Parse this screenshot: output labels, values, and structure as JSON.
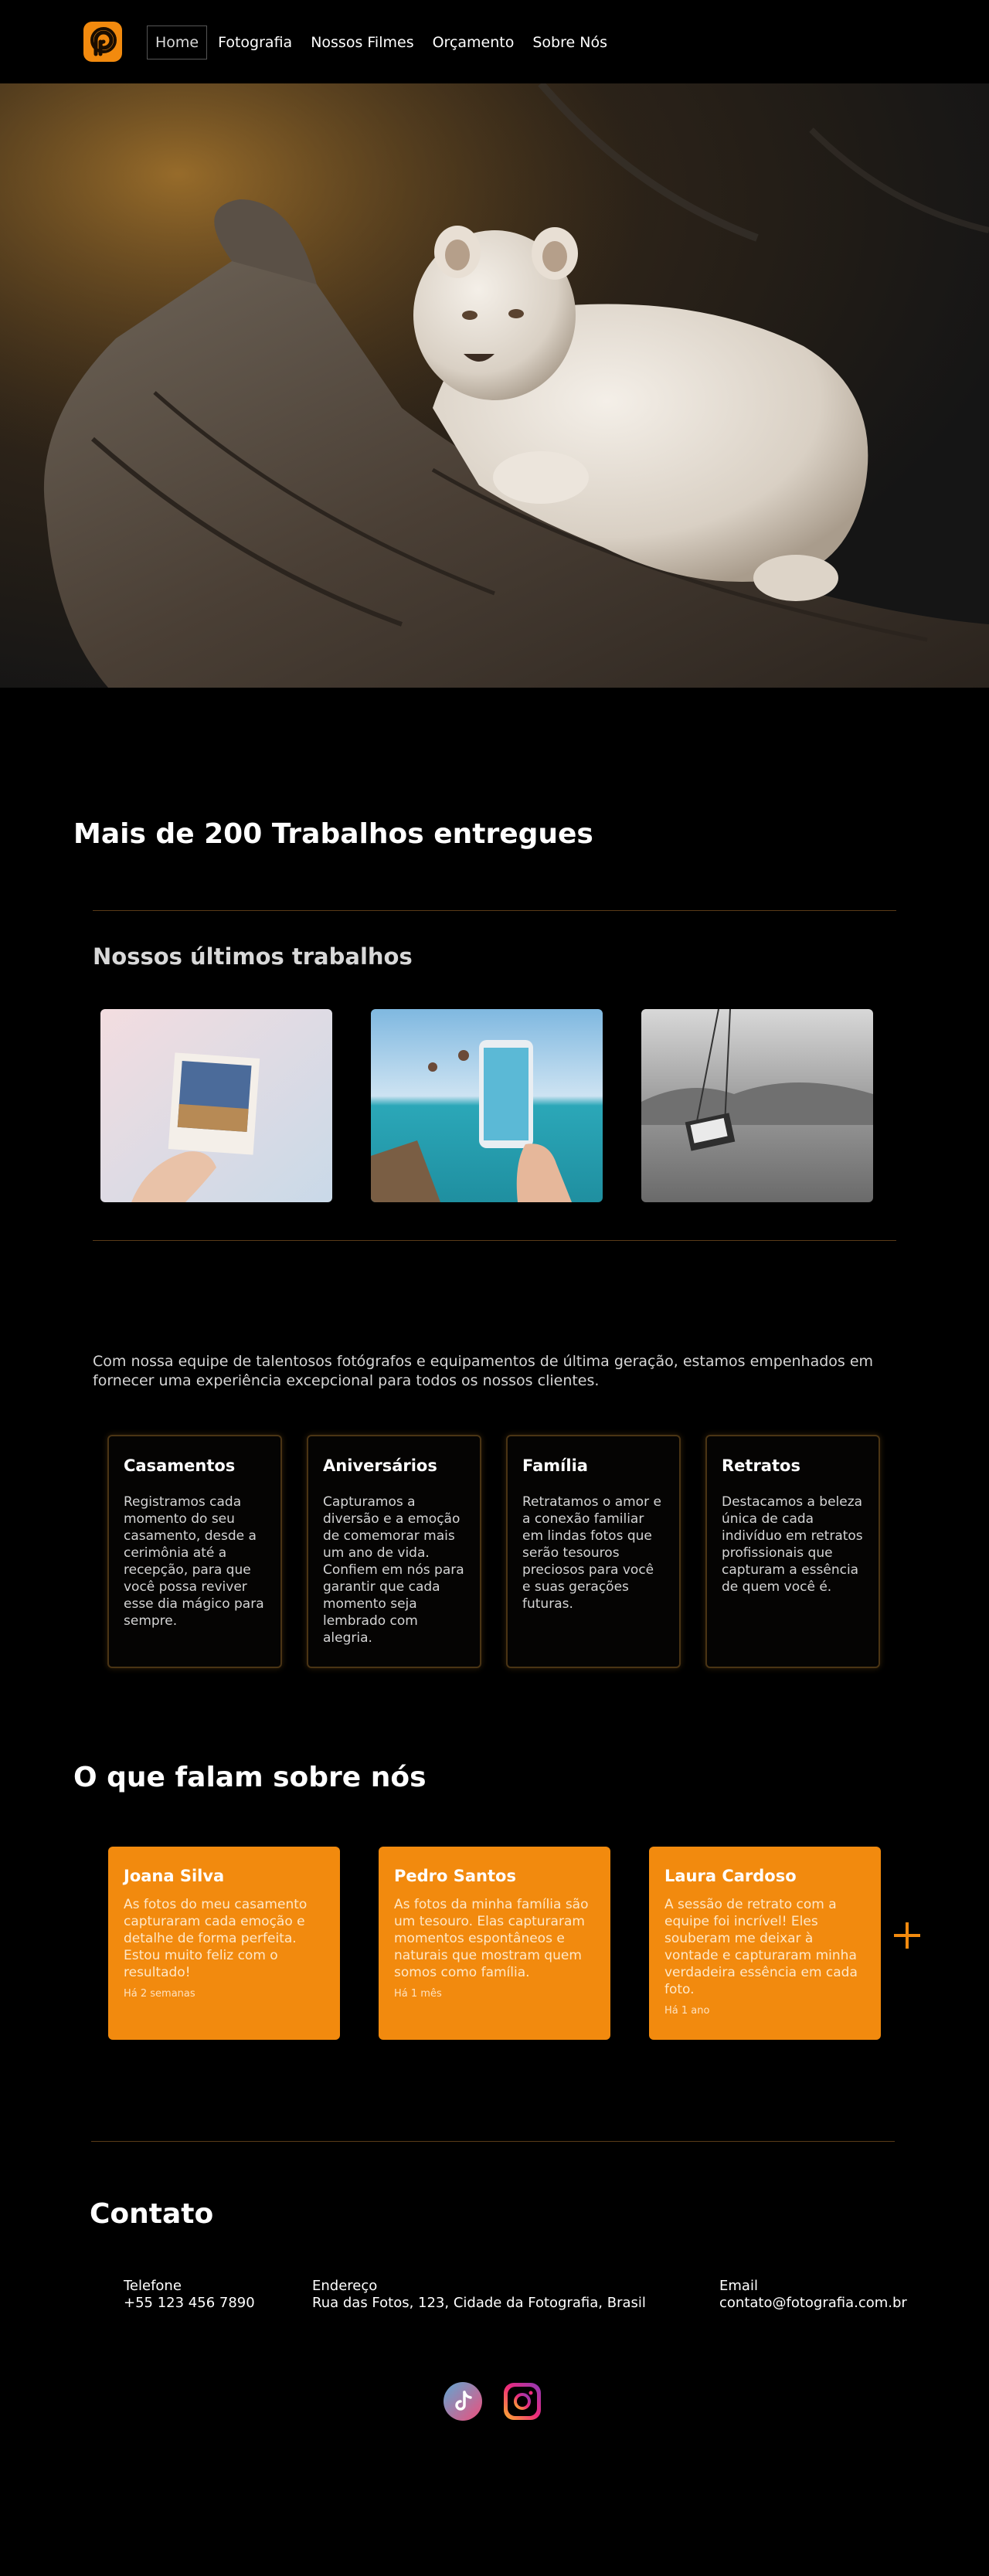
{
  "nav": {
    "items": [
      {
        "label": "Home",
        "active": true
      },
      {
        "label": "Fotografia"
      },
      {
        "label": "Nossos Filmes"
      },
      {
        "label": "Orçamento"
      },
      {
        "label": "Sobre Nós"
      }
    ]
  },
  "hero": {
    "image": "white-lion-cub-on-log-photo"
  },
  "stats": {
    "title": "Mais de 200 Trabalhos entregues"
  },
  "works": {
    "title": "Nossos últimos trabalhos",
    "items": [
      {
        "image": "polaroid-in-hand-photo"
      },
      {
        "image": "people-jumping-into-sea-phone-photo"
      },
      {
        "image": "black-white-swing-photo"
      }
    ]
  },
  "intro": "Com nossa equipe de talentosos fotógrafos e equipamentos de última geração, estamos empenhados em fornecer uma experiência excepcional para todos os nossos clientes.",
  "services": [
    {
      "title": "Casamentos",
      "text": "Registramos cada momento do seu casamento, desde a cerimônia até a recepção, para que você possa reviver esse dia mágico para sempre."
    },
    {
      "title": "Aniversários",
      "text": "Capturamos a diversão e a emoção de comemorar mais um ano de vida. Confiem em nós para garantir  que cada momento seja lembrado com alegria."
    },
    {
      "title": "Família",
      "text": "Retratamos o amor e a conexão familiar em lindas fotos que serão tesouros preciosos para você e suas gerações futuras."
    },
    {
      "title": "Retratos",
      "text": "Destacamos a beleza única de cada indivíduo em retratos profissionais que capturam a essência de quem você é."
    }
  ],
  "testimonials": {
    "title": "O que falam sobre nós",
    "items": [
      {
        "name": "Joana Silva",
        "text": "As fotos do meu casamento capturaram cada emoção e detalhe de forma perfeita. Estou muito feliz com o resultado!",
        "when": "Há 2 semanas"
      },
      {
        "name": "Pedro Santos",
        "text": "As fotos da minha família são um tesouro. Elas capturaram momentos espontâneos e naturais que mostram quem somos como família.",
        "when": "Há 1 mês"
      },
      {
        "name": "Laura Cardoso",
        "text": "A sessão de retrato com a equipe foi incrível! Eles souberam me deixar à vontade e capturaram minha verdadeira essência em cada foto.",
        "when": "Há 1 ano"
      }
    ],
    "more_icon": "plus-icon"
  },
  "contact": {
    "title": "Contato",
    "phone_label": "Telefone",
    "phone": "+55 123 456 7890",
    "address_label": "Endereço",
    "address": "Rua das Fotos, 123, Cidade da Fotografia, Brasil",
    "email_label": "Email",
    "email": "contato@fotografia.com.br"
  },
  "social": [
    {
      "icon": "tiktok-icon"
    },
    {
      "icon": "instagram-icon"
    }
  ],
  "colors": {
    "accent": "#f28a0e",
    "background": "#000000",
    "rule": "#5a3b18"
  }
}
